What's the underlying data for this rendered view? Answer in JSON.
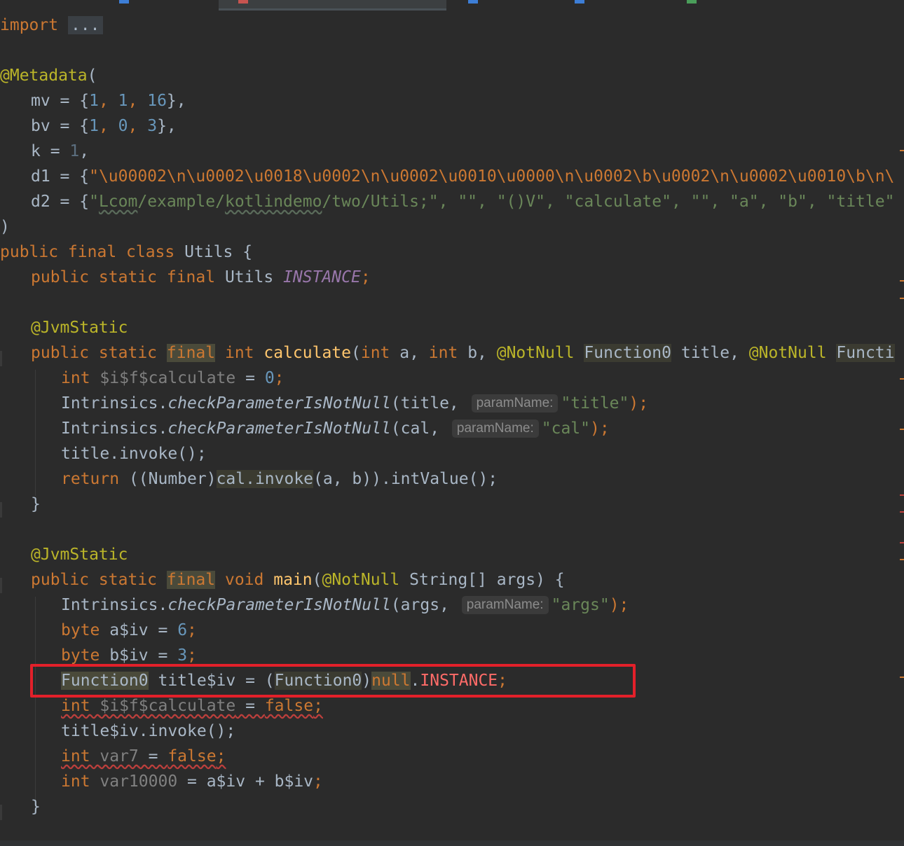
{
  "editor": {
    "line_imports": {
      "kw": "import",
      "fold": "..."
    },
    "line_metadata": {
      "ann": "@Metadata",
      "rest": "("
    },
    "line_mv": {
      "name": "mv",
      "eq": " = {",
      "n1": "1",
      "c1": ", ",
      "n2": "1",
      "c2": ", ",
      "n3": "16",
      "end": "},"
    },
    "line_bv": {
      "name": "bv",
      "eq": " = {",
      "n1": "1",
      "c1": ", ",
      "n2": "0",
      "c2": ", ",
      "n3": "3",
      "end": "},"
    },
    "line_k": {
      "name": "k",
      "eq": " = ",
      "n1": "1",
      "end": ","
    },
    "line_d1": {
      "name": "d1",
      "eq": " = {",
      "str": "\"\\u00002\\n\\u0002\\u0018\\u0002\\n\\u0002\\u0010\\u0000\\n\\u0002\\b\\u0002\\n\\u0002\\u0010\\b\\n\\"
    },
    "line_d2": {
      "name": "d2",
      "eq": " = {",
      "s1a": "\"",
      "s1b": "Lcom",
      "s1c": "/example/",
      "s1d": "kotlindemo",
      "s1e": "/two/Utils;\"",
      "rest": ", \"\", \"()V\", \"calculate\", \"\", \"a\", \"b\", \"title\""
    },
    "line_close_paren": ")",
    "line_class": {
      "kw": "public final class ",
      "name": "Utils",
      "rest": " {"
    },
    "line_instance": {
      "kw": "public static final ",
      "type": "Utils ",
      "fld": "INSTANCE",
      "semi": ";"
    },
    "line_jvm1": "@JvmStatic",
    "line_calc_sig": {
      "kw1": "public static ",
      "kw2": "final",
      "kw3": " int ",
      "fn": "calculate",
      "p1": "(",
      "p2": "int",
      "p3": " a, ",
      "p4": "int",
      "p5": " b, ",
      "ann1": "@NotNull",
      "sp1": " ",
      "t1": "Function0",
      "p6": " title, ",
      "ann2": "@NotNull",
      "sp2": " ",
      "t2": "Functi"
    },
    "line_calc_var": {
      "kw": "int ",
      "gry": "$i$f$calculate",
      "eq": " = ",
      "num": "0",
      "semi": ";"
    },
    "line_check_title": {
      "cls": "Intrinsics.",
      "m": "checkParameterIsNotNull",
      "arg": "(title, ",
      "hint": "paramName:",
      "str": "\"title\"",
      "end": ");"
    },
    "line_check_cal": {
      "cls": "Intrinsics.",
      "m": "checkParameterIsNotNull",
      "arg": "(cal, ",
      "hint": "paramName:",
      "str": "\"cal\"",
      "end": ");"
    },
    "line_title_invoke": "title.invoke();",
    "line_return": {
      "kw": "return ",
      "a": "((Number)",
      "b": "cal.invoke",
      "c": "(a, b)).intValue();"
    },
    "line_close1": "}",
    "line_jvm2": "@JvmStatic",
    "line_main_sig": {
      "kw1": "public static ",
      "kw2": "final",
      "kw3": " void ",
      "fn": "main",
      "p1": "(",
      "ann": "@NotNull",
      "rest": " String[] args) {"
    },
    "line_check_args": {
      "cls": "Intrinsics.",
      "m": "checkParameterIsNotNull",
      "arg": "(args, ",
      "hint": "paramName:",
      "str": "\"args\"",
      "end": ");"
    },
    "line_byte_a": {
      "kw": "byte ",
      "name": "a$iv",
      "eq": " = ",
      "num": "6",
      "semi": ";"
    },
    "line_byte_b": {
      "kw": "byte ",
      "name": "b$iv",
      "eq": " = ",
      "num": "3",
      "semi": ";"
    },
    "line_function0": {
      "t": "Function0",
      "a": " title$iv = (",
      "t2": "Function0",
      "b": ")",
      "kw": "null",
      "dot": ".",
      "err": "INSTANCE",
      "semi": ";"
    },
    "line_int_false1": {
      "kw": "int ",
      "gry": "$i$f$calculate",
      "eq": " = ",
      "kw2": "false",
      "semi": ";"
    },
    "line_title_iv": "title$iv.invoke();",
    "line_int_var7": {
      "kw": "int ",
      "gry": "var7",
      "eq": " = ",
      "kw2": "false",
      "semi": ";"
    },
    "line_int_var10000": {
      "kw": "int ",
      "gry": "var10000",
      "rest": " = a$iv + b$iv",
      "semi": ";"
    },
    "line_close2": "}"
  },
  "colors": {
    "background": "#2b2b2b",
    "keyword": "#cc7832",
    "annotation": "#bbb529",
    "number": "#6897bb",
    "string": "#6a8759",
    "field": "#9876aa",
    "function": "#ffc66d",
    "highlight_box": "#e3202a"
  }
}
